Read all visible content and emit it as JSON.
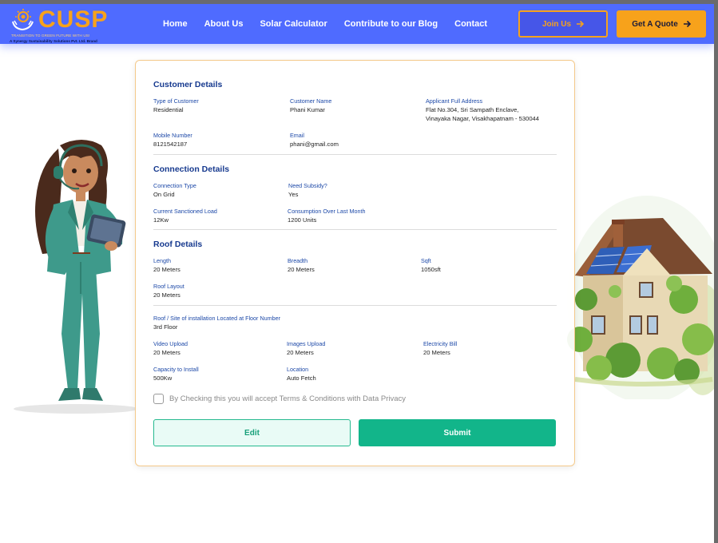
{
  "brand": {
    "name": "CUSP",
    "tagline": "TRANSITION TO GREEN FUTURE WITH US!",
    "sub": "A Synergy Sustainability Solutions Pvt. Ltd. Brand"
  },
  "nav": {
    "links": [
      "Home",
      "About Us",
      "Solar Calculator",
      "Contribute to our Blog",
      "Contact"
    ],
    "join_label": "Join Us",
    "quote_label": "Get A Quote"
  },
  "customer": {
    "title": "Customer Details",
    "type_label": "Type of Customer",
    "type_value": "Residential",
    "name_label": "Customer Name",
    "name_value": "Phani Kumar",
    "address_label": "Applicant Full Address",
    "address_value_line1": "Flat No.304, Sri Sampath Enclave,",
    "address_value_line2": "Vinayaka Nagar, Visakhapatnam - 530044",
    "mobile_label": "Mobile Number",
    "mobile_value": "8121542187",
    "email_label": "Email",
    "email_value": "phani@gmail.com"
  },
  "connection": {
    "title": "Connection Details",
    "type_label": "Connection Type",
    "type_value": "On Grid",
    "subsidy_label": "Need Subsidy?",
    "subsidy_value": "Yes",
    "load_label": "Current Sanctioned Load",
    "load_value": "12Kw",
    "consumption_label": "Consumption Over Last Month",
    "consumption_value": "1200 Units"
  },
  "roof": {
    "title": "Roof Details",
    "length_label": "Length",
    "length_value": "20 Meters",
    "breadth_label": "Breadth",
    "breadth_value": "20 Meters",
    "sqft_label": "Sqft",
    "sqft_value": "1050sft",
    "layout_label": "Roof Layout",
    "layout_value": "20 Meters"
  },
  "site": {
    "floor_label": "Roof / Site of installation Located at Floor Number",
    "floor_value": "3rd Floor",
    "video_label": "Video Upload",
    "video_value": "20 Meters",
    "images_label": "Images Upload",
    "images_value": "20 Meters",
    "bill_label": "Electricity Bill",
    "bill_value": "20 Meters",
    "capacity_label": "Capacity to Install",
    "capacity_value": "500Kw",
    "location_label": "Location",
    "location_value": "Auto Fetch"
  },
  "form": {
    "terms_text": "By Checking this you will accept Terms & Conditions with Data Privacy",
    "terms_checked": false,
    "edit_label": "Edit",
    "submit_label": "Submit"
  },
  "colors": {
    "nav_bg": "#4f6bff",
    "brand_orange": "#f7a21b",
    "section_blue": "#173a8f",
    "submit_green": "#12b58a"
  },
  "icons": [
    "sun-hands-logo-icon",
    "arrow-right-icon"
  ]
}
